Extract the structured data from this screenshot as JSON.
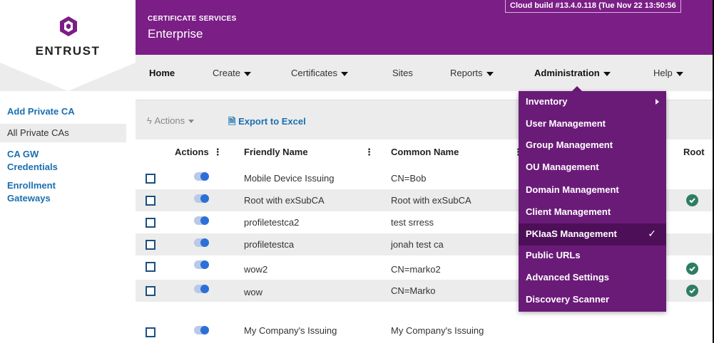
{
  "logo": {
    "text": "ENTRUST"
  },
  "header": {
    "service": "CERTIFICATE SERVICES",
    "edition": "Enterprise",
    "build": "Cloud build #13.4.0.118 (Tue Nov 22 13:50:56"
  },
  "nav": {
    "home": "Home",
    "create": "Create",
    "certificates": "Certificates",
    "sites": "Sites",
    "reports": "Reports",
    "administration": "Administration",
    "help": "Help"
  },
  "sidebar": {
    "items": [
      {
        "label": "Add Private CA"
      },
      {
        "label": "All Private CAs"
      },
      {
        "label": "CA GW Credentials"
      },
      {
        "label": "Enrollment Gateways"
      }
    ]
  },
  "toolbar": {
    "actions": "Actions",
    "export": "Export to Excel"
  },
  "table": {
    "headers": {
      "actions": "Actions",
      "friendly_name": "Friendly Name",
      "common_name": "Common Name",
      "root": "Root"
    },
    "rows": [
      {
        "friendly": "Mobile Device Issuing",
        "common": "CN=Bob",
        "root": false
      },
      {
        "friendly": "Root with exSubCA",
        "common": "Root with exSubCA",
        "root": true
      },
      {
        "friendly": "profiletestca2",
        "common": "test srress",
        "root": false
      },
      {
        "friendly": "profiletestca",
        "common": "jonah test ca",
        "root": false
      },
      {
        "friendly": "wow2",
        "common": "CN=marko2",
        "root": true
      },
      {
        "friendly": "wow",
        "common": "CN=Marko",
        "root": true
      },
      {
        "friendly": "My Company's Issuing",
        "common": "My Company's Issuing",
        "root": false
      }
    ]
  },
  "admin_menu": {
    "items": [
      {
        "label": "Inventory"
      },
      {
        "label": "User Management"
      },
      {
        "label": "Group Management"
      },
      {
        "label": "OU Management"
      },
      {
        "label": "Domain Management"
      },
      {
        "label": "Client Management"
      },
      {
        "label": "PKIaaS Management"
      },
      {
        "label": "Public URLs"
      },
      {
        "label": "Advanced Settings"
      },
      {
        "label": "Discovery Scanner"
      }
    ],
    "active_check": "✓"
  },
  "colors": {
    "brand": "#7b1e86",
    "menu": "#6a1b78",
    "link": "#1a6fb0"
  }
}
